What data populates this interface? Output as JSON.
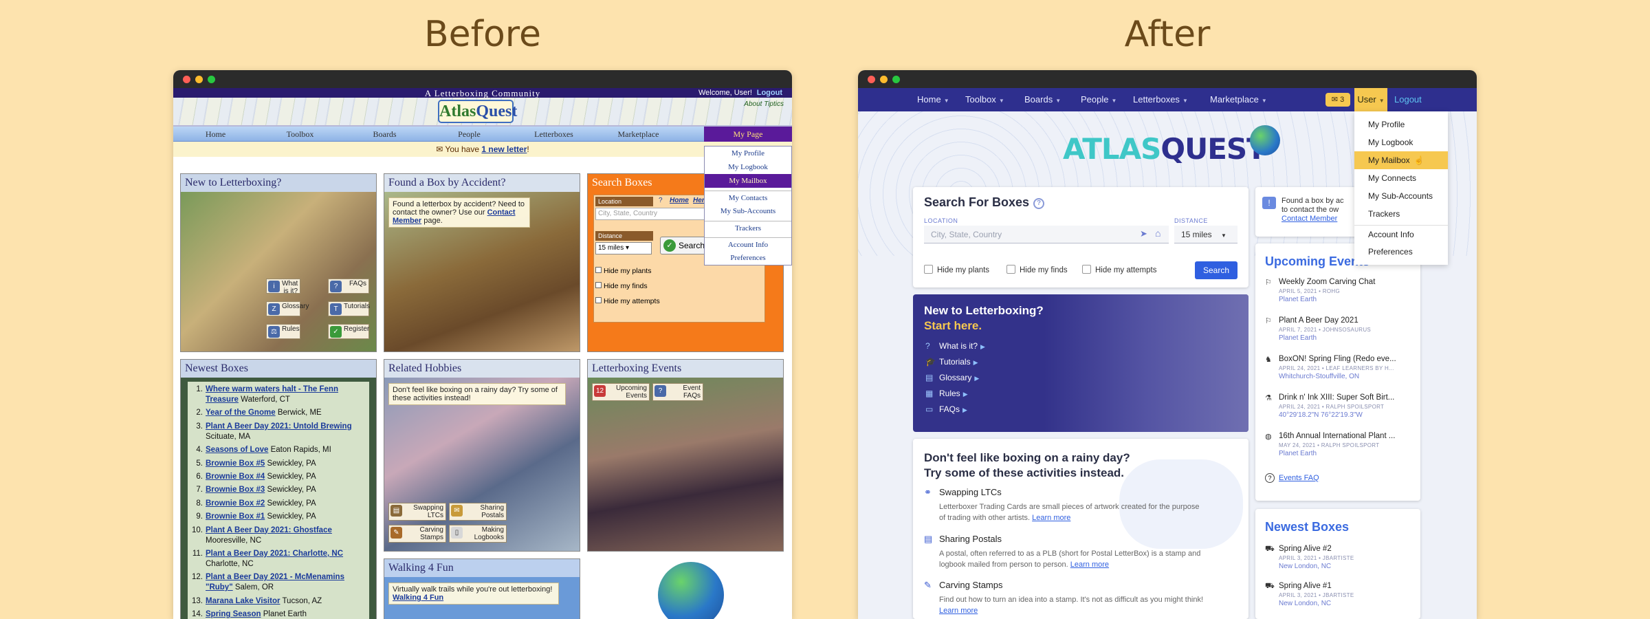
{
  "headings": {
    "before": "Before",
    "after": "After"
  },
  "before": {
    "community": "A Letterboxing Community",
    "welcome": "Welcome, User!",
    "logout": "Logout",
    "logo": {
      "part1": "Atlas",
      "part2": "Quest"
    },
    "about": "About Tiptics",
    "nav": [
      "Home",
      "Toolbox",
      "Boards",
      "People",
      "Letterboxes",
      "Marketplace"
    ],
    "my_page": "My Page",
    "dropdown": [
      "My Profile",
      "My Logbook",
      "My Mailbox",
      "My Contacts",
      "My Sub-Accounts",
      "Trackers",
      "Account Info",
      "Preferences"
    ],
    "letter": {
      "prefix": "You have",
      "link": "1 new letter",
      "suffix": "!"
    },
    "new_panel": {
      "title": "New to Letterboxing?",
      "buttons": [
        "What is it?",
        "FAQs",
        "Glossary",
        "Tutorials",
        "Rules",
        "Register"
      ]
    },
    "found_panel": {
      "title": "Found a Box by Accident?",
      "note": "Found a letterbox by accident? Need to contact the owner? Use our",
      "link": "Contact Member",
      "suffix": "page."
    },
    "search_panel": {
      "title": "Search Boxes",
      "location_label": "Location",
      "home": "Home",
      "here": "Here",
      "placeholder": "City, State, Country",
      "distance_label": "Distance",
      "distance": "15 miles",
      "search": "Search",
      "checks": [
        "Hide my plants",
        "Hide my finds",
        "Hide my attempts"
      ]
    },
    "newest": {
      "title": "Newest Boxes",
      "items": [
        {
          "num": "1.",
          "name": "Where warm waters halt - The Fenn Treasure",
          "loc": "Waterford, CT"
        },
        {
          "num": "2.",
          "name": "Year of the Gnome",
          "loc": "Berwick, ME"
        },
        {
          "num": "3.",
          "name": "Plant A Beer Day 2021: Untold Brewing",
          "loc": "Scituate, MA"
        },
        {
          "num": "4.",
          "name": "Seasons of Love",
          "loc": "Eaton Rapids, MI"
        },
        {
          "num": "5.",
          "name": "Brownie Box #5",
          "loc": "Sewickley, PA"
        },
        {
          "num": "6.",
          "name": "Brownie Box #4",
          "loc": "Sewickley, PA"
        },
        {
          "num": "7.",
          "name": "Brownie Box #3",
          "loc": "Sewickley, PA"
        },
        {
          "num": "8.",
          "name": "Brownie Box #2",
          "loc": "Sewickley, PA"
        },
        {
          "num": "9.",
          "name": "Brownie Box #1",
          "loc": "Sewickley, PA"
        },
        {
          "num": "10.",
          "name": "Plant A Beer Day 2021: Ghostface",
          "loc": "Mooresville, NC"
        },
        {
          "num": "11.",
          "name": "Plant a Beer Day 2021: Charlotte, NC",
          "loc": "Charlotte, NC"
        },
        {
          "num": "12.",
          "name": "Plant a Beer Day 2021 - McMenamins \"Ruby\"",
          "loc": "Salem, OR"
        },
        {
          "num": "13.",
          "name": "Marana Lake Visitor",
          "loc": "Tucson, AZ"
        },
        {
          "num": "14.",
          "name": "Spring Season",
          "loc": "Planet Earth"
        }
      ]
    },
    "hobbies": {
      "title": "Related Hobbies",
      "note": "Don't feel like boxing on a rainy day? Try some of these activities instead!",
      "buttons": [
        "Swapping LTCs",
        "Sharing Postals",
        "Carving Stamps",
        "Making Logbooks"
      ]
    },
    "events": {
      "title": "Letterboxing Events",
      "buttons": [
        "Upcoming Events",
        "Event FAQs"
      ]
    },
    "walking": {
      "title": "Walking 4 Fun",
      "note": "Virtually walk trails while you're out letterboxing!",
      "link": "Walking 4 Fun"
    }
  },
  "after": {
    "nav": [
      "Home",
      "Toolbox",
      "Boards",
      "People",
      "Letterboxes",
      "Marketplace"
    ],
    "mail_count": "3",
    "user": "User",
    "logout": "Logout",
    "logo": {
      "part1": "ATLAS",
      "part2": "QUEST"
    },
    "dropdown": [
      "My Profile",
      "My Logbook",
      "My Mailbox",
      "My Connects",
      "My Sub-Accounts",
      "Trackers",
      "Account Info",
      "Preferences"
    ],
    "search": {
      "title": "Search For Boxes",
      "location_label": "LOCATION",
      "placeholder": "City, State, Country",
      "distance_label": "DISTANCE",
      "distance": "15 miles",
      "checks": [
        "Hide my plants",
        "Hide my finds",
        "Hide my attempts"
      ],
      "button": "Search"
    },
    "found": {
      "text1": "Found a box by ac",
      "text2": "to contact the ow",
      "link": "Contact Member"
    },
    "new_to": {
      "title": "New to Letterboxing?",
      "subtitle": "Start here.",
      "links": [
        "What is it?",
        "Tutorials",
        "Glossary",
        "Rules",
        "FAQs"
      ]
    },
    "hobbies": {
      "title1": "Don't feel like boxing on a rainy day?",
      "title2": "Try some of these activities instead.",
      "items": [
        {
          "name": "Swapping LTCs",
          "desc": "Letterboxer Trading Cards are small pieces of artwork created for the purpose of trading with other artists.",
          "more": "Learn more"
        },
        {
          "name": "Sharing Postals",
          "desc": "A postal, often referred to as a PLB (short for Postal LetterBox) is a stamp and logbook mailed from person to person.",
          "more": "Learn more"
        },
        {
          "name": "Carving Stamps",
          "desc": "Find out how to turn an idea into a stamp. It's not as difficult as you might think!",
          "more": "Learn more"
        }
      ]
    },
    "events": {
      "title": "Upcoming Events",
      "items": [
        {
          "name": "Weekly Zoom Carving Chat",
          "date": "APRIL 5, 2021 • ROHG",
          "place": "Planet Earth"
        },
        {
          "name": "Plant A Beer Day 2021",
          "date": "APRIL 7, 2021 • JOHNSOSAURUS",
          "place": "Planet Earth"
        },
        {
          "name": "BoxON! Spring Fling (Redo eve...",
          "date": "APRIL 24, 2021 • LEAF LEARNERS BY H...",
          "place": "Whitchurch-Stouffville, ON"
        },
        {
          "name": "Drink n' Ink XIII: Super Soft Birt...",
          "date": "APRIL 24, 2021 • RALPH SPOILSPORT",
          "place": "40°29'18.2\"N 76°22'19.3\"W"
        },
        {
          "name": "16th Annual International Plant ...",
          "date": "MAY 24, 2021 • RALPH SPOILSPORT",
          "place": "Planet Earth"
        }
      ],
      "faq": "Events FAQ"
    },
    "newest": {
      "title": "Newest Boxes",
      "items": [
        {
          "name": "Spring Alive #2",
          "date": "APRIL 3, 2021 • JBARTISTE",
          "place": "New London, NC"
        },
        {
          "name": "Spring Alive #1",
          "date": "APRIL 3, 2021 • JBARTISTE",
          "place": "New London, NC"
        }
      ]
    }
  }
}
